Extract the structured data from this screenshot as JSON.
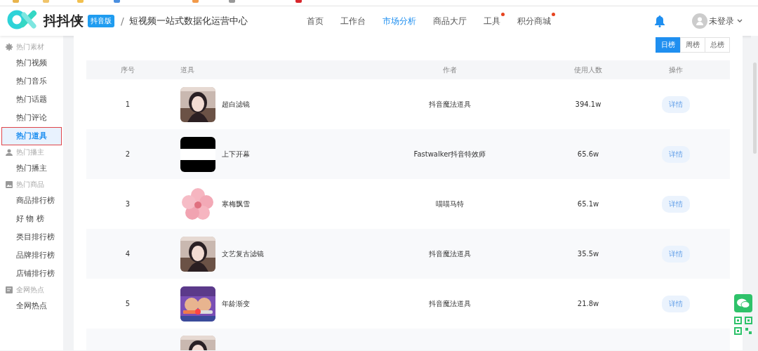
{
  "header": {
    "brand": "抖抖侠",
    "edition_badge": "抖音版",
    "separator": "/",
    "subtitle": "短视频一站式数据化运营中心",
    "nav": [
      {
        "label": "首页",
        "selected": false,
        "dot": false
      },
      {
        "label": "工作台",
        "selected": false,
        "dot": false
      },
      {
        "label": "市场分析",
        "selected": true,
        "dot": false
      },
      {
        "label": "商品大厅",
        "selected": false,
        "dot": false
      },
      {
        "label": "工具",
        "selected": false,
        "dot": true
      },
      {
        "label": "积分商城",
        "selected": false,
        "dot": true
      }
    ],
    "user": "未登录"
  },
  "sidebar": {
    "groups": [
      {
        "title": "热门素材",
        "items": [
          {
            "label": "热门视频",
            "selected": false,
            "highlighted": false
          },
          {
            "label": "热门音乐",
            "selected": false,
            "highlighted": false
          },
          {
            "label": "热门话题",
            "selected": false,
            "highlighted": false
          },
          {
            "label": "热门评论",
            "selected": false,
            "highlighted": false
          },
          {
            "label": "热门道具",
            "selected": true,
            "highlighted": true
          }
        ]
      },
      {
        "title": "热门播主",
        "items": [
          {
            "label": "热门播主",
            "selected": false,
            "highlighted": false
          }
        ]
      },
      {
        "title": "热门商品",
        "items": [
          {
            "label": "商品排行榜",
            "selected": false,
            "highlighted": false
          },
          {
            "label": "好 物 榜",
            "selected": false,
            "highlighted": false
          },
          {
            "label": "类目排行榜",
            "selected": false,
            "highlighted": false
          },
          {
            "label": "品牌排行榜",
            "selected": false,
            "highlighted": false
          },
          {
            "label": "店铺排行榜",
            "selected": false,
            "highlighted": false
          }
        ]
      },
      {
        "title": "全网热点",
        "items": [
          {
            "label": "全网热点",
            "selected": false,
            "highlighted": false
          }
        ]
      }
    ]
  },
  "range_tabs": [
    {
      "label": "日榜",
      "selected": true
    },
    {
      "label": "周榜",
      "selected": false
    },
    {
      "label": "总榜",
      "selected": false
    }
  ],
  "table": {
    "columns": [
      "序号",
      "道具",
      "作者",
      "使用人数",
      "操作"
    ],
    "rows": [
      {
        "kind": "full",
        "rank": "1",
        "name": "超白滤镜",
        "author": "抖音魔法道具",
        "users": "394.1w",
        "action": "详情"
      },
      {
        "kind": "full",
        "rank": "2",
        "name": "上下开幕",
        "author": "Fastwalker抖音特效师",
        "users": "65.6w",
        "action": "详情"
      },
      {
        "kind": "full",
        "rank": "3",
        "name": "寒梅飘雪",
        "author": "喵喵马特",
        "users": "65.1w",
        "action": "详情"
      },
      {
        "kind": "full",
        "rank": "4",
        "name": "文艺复古滤镜",
        "author": "抖音魔法道具",
        "users": "35.5w",
        "action": "详情"
      },
      {
        "kind": "full",
        "rank": "5",
        "name": "年龄渐变",
        "author": "抖音魔法道具",
        "users": "21.8w",
        "action": "详情"
      },
      {
        "kind": "partial"
      }
    ]
  }
}
